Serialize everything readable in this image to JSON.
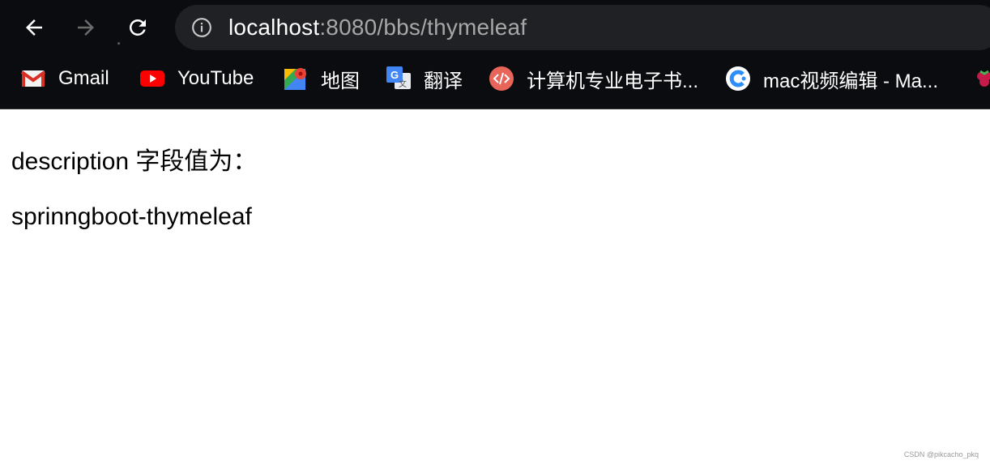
{
  "browser": {
    "url_host": "localhost",
    "url_rest": ":8080/bbs/thymeleaf",
    "bookmarks": [
      {
        "label": "Gmail",
        "icon": "gmail-icon"
      },
      {
        "label": "YouTube",
        "icon": "youtube-icon"
      },
      {
        "label": "地图",
        "icon": "maps-icon"
      },
      {
        "label": "翻译",
        "icon": "translate-icon"
      },
      {
        "label": "计算机专业电子书...",
        "icon": "code-icon"
      },
      {
        "label": "mac视频编辑 - Ma...",
        "icon": "c-logo-icon"
      },
      {
        "label": "",
        "icon": "raspberry-icon"
      }
    ]
  },
  "page": {
    "line1": "description 字段值为：",
    "line2": "sprinngboot-thymeleaf"
  },
  "watermark": "CSDN @pikcacho_pkq",
  "colors": {
    "toolbar_bg": "#0b0c10",
    "omnibox_bg": "#202124",
    "url_rest": "#a7a7a7"
  }
}
